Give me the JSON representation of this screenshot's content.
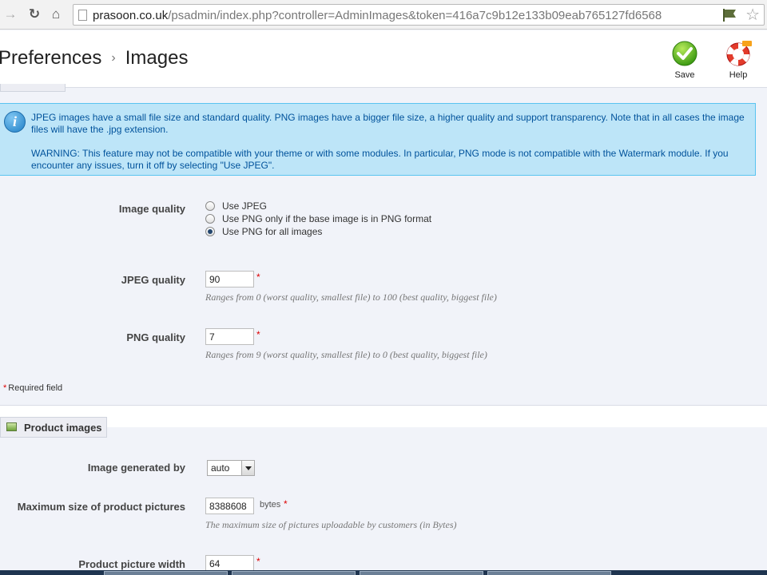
{
  "browser": {
    "url_host": "prasoon.co.uk",
    "url_path": "/psadmin/index.php?controller=AdminImages&token=416a7c9b12e133b09eab765127fd6568"
  },
  "header": {
    "breadcrumb_parent": "Preferences",
    "breadcrumb_current": "Images",
    "save_label": "Save",
    "help_label": "Help"
  },
  "info": {
    "line1": "JPEG images have a small file size and standard quality. PNG images have a bigger file size, a higher quality and support transparency. Note that in all cases the image files will have the .jpg extension.",
    "line2": "WARNING: This feature may not be compatible with your theme or with some modules. In particular, PNG mode is not compatible with the Watermark module. If you encounter any issues, turn it off by selecting \"Use JPEG\"."
  },
  "image_quality": {
    "label": "Image quality",
    "options": [
      {
        "label": "Use JPEG",
        "checked": false
      },
      {
        "label": "Use PNG only if the base image is in PNG format",
        "checked": false
      },
      {
        "label": "Use PNG for all images",
        "checked": true
      }
    ]
  },
  "jpeg_quality": {
    "label": "JPEG quality",
    "value": "90",
    "required": "*",
    "hint": "Ranges from 0 (worst quality, smallest file) to 100 (best quality, biggest file)"
  },
  "png_quality": {
    "label": "PNG quality",
    "value": "7",
    "required": "*",
    "hint": "Ranges from 9 (worst quality, smallest file) to 0 (best quality, biggest file)"
  },
  "required_note": "Required field",
  "product_images": {
    "legend": "Product images",
    "generated_by": {
      "label": "Image generated by",
      "value": "auto"
    },
    "max_size": {
      "label": "Maximum size of product pictures",
      "value": "8388608",
      "unit": "bytes",
      "required": "*",
      "hint": "The maximum size of pictures uploadable by customers (in Bytes)"
    },
    "picture_width": {
      "label": "Product picture width",
      "value": "64",
      "required": "*"
    }
  }
}
